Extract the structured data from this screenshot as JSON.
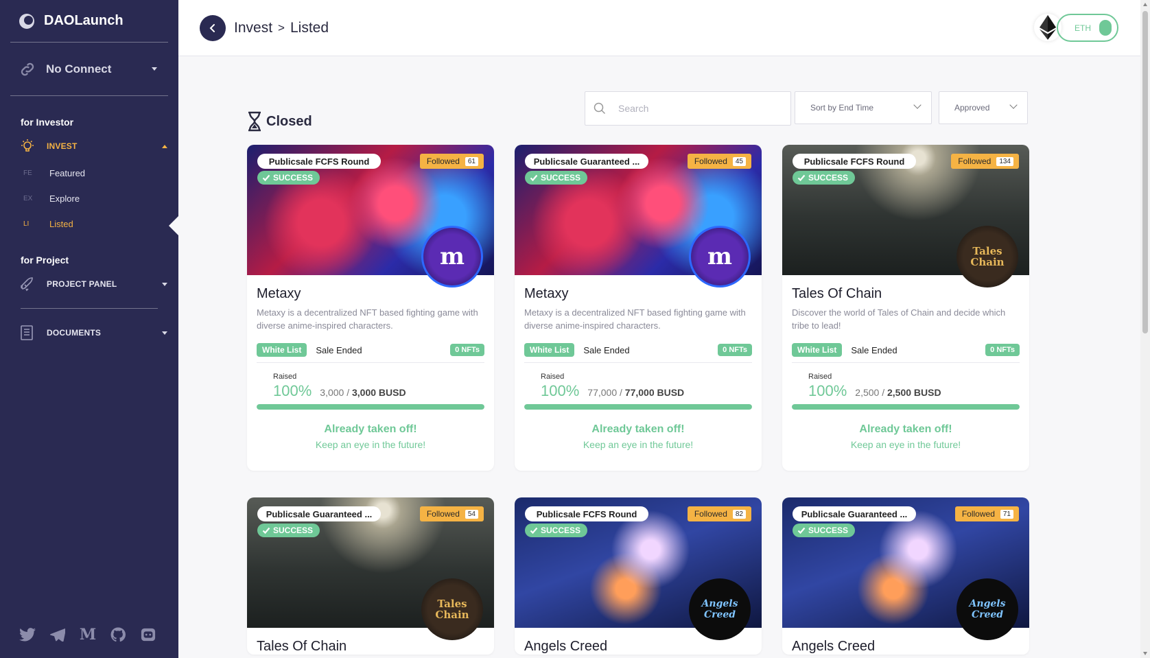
{
  "brand": {
    "name": "DAOLaunch"
  },
  "wallet": {
    "label": "No Connect"
  },
  "sidebar": {
    "investor_title": "for Investor",
    "invest_label": "INVEST",
    "sub_items": [
      {
        "abbr": "FE",
        "label": "Featured"
      },
      {
        "abbr": "EX",
        "label": "Explore"
      },
      {
        "abbr": "LI",
        "label": "Listed"
      }
    ],
    "project_title": "for Project",
    "project_panel_label": "PROJECT PANEL",
    "documents_label": "DOCUMENTS",
    "socials": [
      "twitter-icon",
      "telegram-icon",
      "medium-icon",
      "github-icon",
      "discord-icon"
    ]
  },
  "header": {
    "crumb_parent": "Invest",
    "crumb_sep": ">",
    "crumb_current": "Listed",
    "network_toggle_label": "ETH"
  },
  "filters": {
    "search_placeholder": "Search",
    "sort_value": "Sort by End Time",
    "status_value": "Approved"
  },
  "section": {
    "title": "Closed"
  },
  "labels": {
    "success": "SUCCESS",
    "followed": "Followed",
    "whitelist": "White List",
    "sale_ended": "Sale Ended",
    "raised": "Raised",
    "cta_title": "Already taken off!",
    "cta_sub": "Keep an eye in the future!"
  },
  "cards": [
    {
      "round": "Publicsale FCFS Round",
      "followed": "61",
      "name": "Metaxy",
      "desc": "Metaxy is a decentralized NFT based fighting game with diverse anime-inspired characters.",
      "nfts": "0 NFTs",
      "pct": "100%",
      "raised": "3,000",
      "total": "3,000 BUSD",
      "progress": 1.0,
      "theme": "metaxy",
      "logo_text": "m"
    },
    {
      "round": "Publicsale Guaranteed ...",
      "followed": "45",
      "name": "Metaxy",
      "desc": "Metaxy is a decentralized NFT based fighting game with diverse anime-inspired characters.",
      "nfts": "0 NFTs",
      "pct": "100%",
      "raised": "77,000",
      "total": "77,000 BUSD",
      "progress": 1.0,
      "theme": "metaxy",
      "logo_text": "m"
    },
    {
      "round": "Publicsale FCFS Round",
      "followed": "134",
      "name": "Tales Of Chain",
      "desc": "Discover the world of Tales of Chain and decide which tribe to lead!",
      "nfts": "0 NFTs",
      "pct": "100%",
      "raised": "2,500",
      "total": "2,500 BUSD",
      "progress": 1.0,
      "theme": "tales",
      "logo_text": "Tales Chain"
    },
    {
      "round": "Publicsale Guaranteed ...",
      "followed": "54",
      "name": "Tales Of Chain",
      "theme": "tales",
      "logo_text": "Tales Chain"
    },
    {
      "round": "Publicsale FCFS Round",
      "followed": "82",
      "name": "Angels Creed",
      "theme": "angels",
      "logo_text": "Angels Creed"
    },
    {
      "round": "Publicsale Guaranteed ...",
      "followed": "71",
      "name": "Angels Creed",
      "theme": "angels",
      "logo_text": "Angels Creed"
    }
  ]
}
